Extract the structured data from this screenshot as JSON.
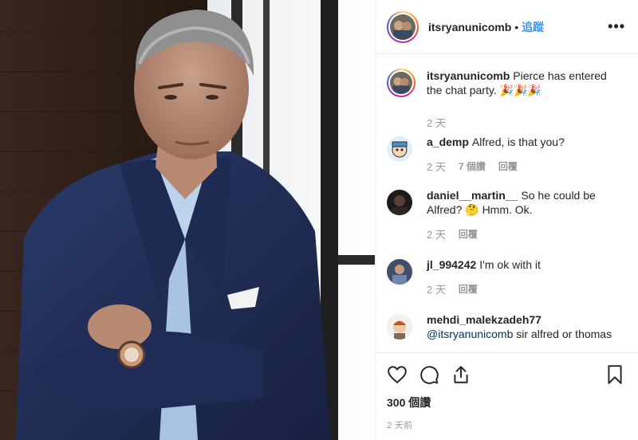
{
  "header": {
    "username": "itsryanunicomb",
    "separator": "•",
    "follow_label": "追蹤",
    "more_label": "•••"
  },
  "caption": {
    "username": "itsryanunicomb",
    "text": "Pierce has entered the chat party. 🎉🎉🎉",
    "time": "2 天"
  },
  "comments": [
    {
      "username": "a_demp",
      "text": "Alfred, is that you?",
      "time": "2 天",
      "likes": "7 個讚",
      "reply": "回覆"
    },
    {
      "username": "daniel__martin__",
      "text": "So he could be Alfred? 🤔 Hmm. Ok.",
      "time": "2 天",
      "reply": "回覆"
    },
    {
      "username": "jl_994242",
      "text": "I'm ok with it",
      "time": "2 天",
      "reply": "回覆"
    },
    {
      "username": "mehdi_malekzadeh77",
      "mention": "@itsryanunicomb",
      "text": "sir alfred or thomas"
    }
  ],
  "footer": {
    "views": "300 個讚",
    "age": "2 天前"
  },
  "icons": {
    "like": "heart-icon",
    "comment": "comment-bubble-icon",
    "share": "share-icon",
    "save": "bookmark-icon"
  },
  "colors": {
    "accent": "#3897f0",
    "mention": "#003569",
    "muted": "#999999",
    "text": "#262626"
  }
}
